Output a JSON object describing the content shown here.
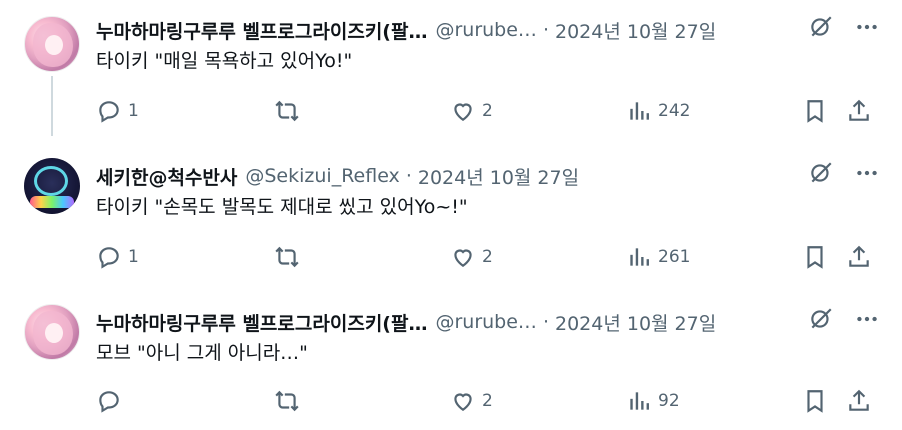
{
  "posts": [
    {
      "avatar": "pink-haired-character-avatar",
      "name": "누마하마링구루루 벨프로그라이즈키(팔…",
      "handle": "@rurube…",
      "date": "2024년 10월 27일",
      "text": "타이키 \"매일 목욕하고 있어Yo!\"",
      "replies": "1",
      "retweets": "",
      "likes": "2",
      "views": "242"
    },
    {
      "avatar": "teal-emblem-avatar",
      "name": "세키한@척수반사",
      "handle": "@Sekizui_Reflex",
      "date": "2024년 10월 27일",
      "text": "타이키 \"손목도 발목도 제대로 씼고 있어Yo~!\"",
      "replies": "1",
      "retweets": "",
      "likes": "2",
      "views": "261"
    },
    {
      "avatar": "pink-haired-character-avatar",
      "name": "누마하마링구루루 벨프로그라이즈키(팔…",
      "handle": "@rurube…",
      "date": "2024년 10월 27일",
      "text": "모브 \"아니 그게 아니라…\"",
      "replies": "",
      "retweets": "",
      "likes": "2",
      "views": "92"
    }
  ],
  "separator": "·",
  "icons": {
    "grok": "grok-icon",
    "more": "more-icon",
    "reply": "reply-icon",
    "retweet": "retweet-icon",
    "like": "heart-icon",
    "views": "views-icon",
    "bookmark": "bookmark-icon",
    "share": "share-icon"
  },
  "colors": {
    "text": "#0f1419",
    "muted": "#536471",
    "thread": "#cfd9de"
  }
}
